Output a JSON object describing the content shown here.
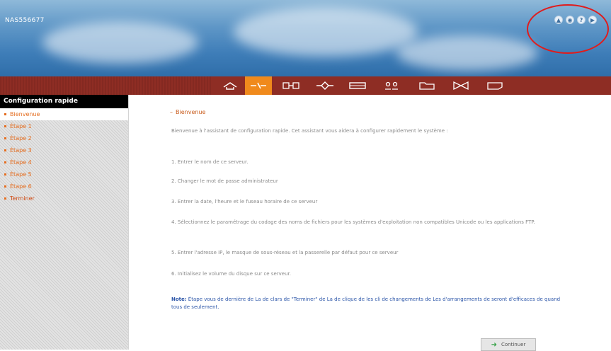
{
  "header": {
    "title": "NAS556677",
    "top_icons": [
      "home-circle-icon",
      "refresh-circle-icon",
      "help-circle-icon",
      "logout-circle-icon"
    ],
    "top_icon_glyphs": [
      "▲",
      "◉",
      "?",
      "▶"
    ]
  },
  "navbar": {
    "items": [
      {
        "name": "home-icon",
        "active": false
      },
      {
        "name": "quick-config-icon",
        "active": true
      },
      {
        "name": "system-settings-icon",
        "active": false
      },
      {
        "name": "network-icon",
        "active": false
      },
      {
        "name": "disk-icon",
        "active": false
      },
      {
        "name": "users-icon",
        "active": false
      },
      {
        "name": "share-folder-icon",
        "active": false
      },
      {
        "name": "transfer-icon",
        "active": false
      },
      {
        "name": "system-tools-icon",
        "active": false
      }
    ]
  },
  "sidebar": {
    "header": "Configuration rapide",
    "items": [
      {
        "label": "Bienvenue",
        "active": true
      },
      {
        "label": "Étape 1",
        "active": false
      },
      {
        "label": "Étape 2",
        "active": false
      },
      {
        "label": "Étape 3",
        "active": false
      },
      {
        "label": "Étape 4",
        "active": false
      },
      {
        "label": "Étape 5",
        "active": false
      },
      {
        "label": "Étape 6",
        "active": false
      },
      {
        "label": "Terminer",
        "active": false
      }
    ]
  },
  "main": {
    "section_title": "Bienvenue",
    "intro": "Bienvenue à l'assistant de configuration rapide. Cet assistant vous aidera à configurer rapidement le système :",
    "steps": [
      "1. Entrer le nom de ce serveur.",
      "2. Changer le mot de passe administrateur",
      "3. Entrer la date, l'heure et le fuseau horaire de ce serveur",
      "4. Sélectionnez le paramétrage du codage des noms de fichiers pour les systèmes d'exploitation non compatibles Unicode ou les applications FTP.",
      "5. Entrer l'adresse IP, le masque de sous-réseau et la passerelle par défaut pour ce serveur",
      "6. Initialisez le volume du disque sur ce serveur."
    ],
    "note_label": "Note:",
    "note_text": "Étape vous de dernière de La de clars de \"Terminer\" de La de clique de les cli de changements de Les d'arrangements de seront d'efficaces de quand tous de seulement.",
    "continue_label": "Continuer"
  },
  "colors": {
    "navbar": "#8e2d24",
    "nav_active": "#f08a1c",
    "accent_orange": "#e46c1e",
    "note_blue": "#2b55a8",
    "highlight_red": "#e01c1c"
  }
}
